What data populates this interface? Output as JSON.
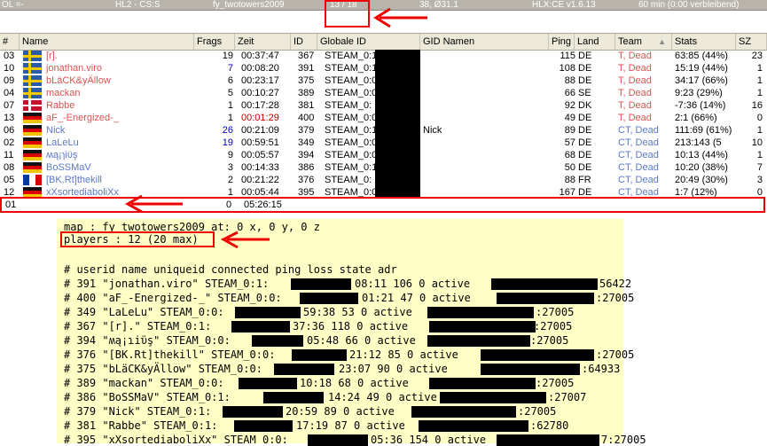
{
  "status_bar": {
    "left": "OL =-",
    "game": "HL2 - CS:S",
    "map": "fy_twotowers2009",
    "players": "13 / 18",
    "ping": "38, Ø31.1",
    "mod": "HLX:CE v1.6.13",
    "time": "60 min (0:00 verbleibend)"
  },
  "table": {
    "headers": [
      "#",
      "Name",
      "Frags",
      "Zeit",
      "ID",
      "Globale ID",
      "GID Namen",
      "Ping",
      "Land",
      "Team",
      "Stats",
      "SZ"
    ],
    "sort_indicator": "▲",
    "rows": [
      {
        "n": "03",
        "name": "[r].",
        "frags": "19",
        "time": "00:37:47",
        "id": "367",
        "gid": "STEAM_0:1",
        "gidname": "",
        "ping": "115",
        "land": "DE",
        "team": "T, Dead",
        "stats": "63:85 (44%)",
        "sz": "23",
        "flag": "se",
        "color": "#e05050",
        "fcolor": "#000",
        "tcolor": "#000"
      },
      {
        "n": "10",
        "name": "jonathan.viro",
        "frags": "7",
        "time": "00:08:20",
        "id": "391",
        "gid": "STEAM_0:1",
        "gidname": "",
        "ping": "108",
        "land": "DE",
        "team": "T, Dead",
        "stats": "15:19 (44%)",
        "sz": "1",
        "flag": "se",
        "color": "#e05050",
        "fcolor": "#0000c0",
        "tcolor": "#000"
      },
      {
        "n": "09",
        "name": "bLäCK&yÄllow",
        "frags": "6",
        "time": "00:23:17",
        "id": "375",
        "gid": "STEAM_0:0",
        "gidname": "",
        "ping": "88",
        "land": "DE",
        "team": "T, Dead",
        "stats": "34:17 (66%)",
        "sz": "1",
        "flag": "se",
        "color": "#e05050",
        "fcolor": "#000",
        "tcolor": "#000"
      },
      {
        "n": "04",
        "name": "mackan",
        "frags": "5",
        "time": "00:10:27",
        "id": "389",
        "gid": "STEAM_0:0",
        "gidname": "",
        "ping": "66",
        "land": "SE",
        "team": "T, Dead",
        "stats": "9:23 (29%)",
        "sz": "1",
        "flag": "se",
        "color": "#e05050",
        "fcolor": "#000",
        "tcolor": "#000"
      },
      {
        "n": "07",
        "name": "Rabbe",
        "frags": "1",
        "time": "00:17:28",
        "id": "381",
        "gid": "STEAM_0:",
        "gidname": "",
        "ping": "92",
        "land": "DK",
        "team": "T, Dead",
        "stats": "-7:36 (14%)",
        "sz": "16",
        "flag": "dk",
        "color": "#e05050",
        "fcolor": "#000",
        "tcolor": "#000"
      },
      {
        "n": "13",
        "name": "aF_-Energized-_",
        "frags": "1",
        "time": "00:01:29",
        "id": "400",
        "gid": "STEAM_0:0",
        "gidname": "",
        "ping": "49",
        "land": "DE",
        "team": "T, Dead",
        "stats": "2:1 (66%)",
        "sz": "0",
        "flag": "de",
        "color": "#e05050",
        "fcolor": "#000",
        "tcolor": "#c00000"
      },
      {
        "n": "06",
        "name": "Nick",
        "frags": "26",
        "time": "00:21:09",
        "id": "379",
        "gid": "STEAM_0:1",
        "gidname": "Nick",
        "ping": "89",
        "land": "DE",
        "team": "CT, Dead",
        "stats": "111:69 (61%)",
        "sz": "1",
        "flag": "de",
        "color": "#5a78c8",
        "fcolor": "#0000c0",
        "tcolor": "#000"
      },
      {
        "n": "02",
        "name": "LaLeLu",
        "frags": "19",
        "time": "00:59:51",
        "id": "349",
        "gid": "STEAM_0:0",
        "gidname": "",
        "ping": "57",
        "land": "DE",
        "team": "CT, Dead",
        "stats": "213:143 (5",
        "sz": "10",
        "flag": "de",
        "color": "#5a78c8",
        "fcolor": "#0000c0",
        "tcolor": "#000"
      },
      {
        "n": "11",
        "name": "ʍą¡ɿiϋş",
        "frags": "9",
        "time": "00:05:57",
        "id": "394",
        "gid": "STEAM_0:0",
        "gidname": "",
        "ping": "68",
        "land": "DE",
        "team": "CT, Dead",
        "stats": "10:13 (44%)",
        "sz": "1",
        "flag": "de",
        "color": "#5a78c8",
        "fcolor": "#000",
        "tcolor": "#000"
      },
      {
        "n": "08",
        "name": "BoSSMaV",
        "frags": "3",
        "time": "00:14:33",
        "id": "386",
        "gid": "STEAM_0:1",
        "gidname": "",
        "ping": "50",
        "land": "DE",
        "team": "CT, Dead",
        "stats": "10:20 (38%)",
        "sz": "7",
        "flag": "de",
        "color": "#5a78c8",
        "fcolor": "#000",
        "tcolor": "#000"
      },
      {
        "n": "05",
        "name": "[BK.Rt]thekill",
        "frags": "2",
        "time": "00:21:22",
        "id": "376",
        "gid": "STEAM_0:",
        "gidname": "",
        "ping": "88",
        "land": "FR",
        "team": "CT, Dead",
        "stats": "20:49 (30%)",
        "sz": "3",
        "flag": "fr",
        "color": "#5a78c8",
        "fcolor": "#000",
        "tcolor": "#000"
      },
      {
        "n": "12",
        "name": "xXsortediaboliXx",
        "frags": "1",
        "time": "00:05:44",
        "id": "395",
        "gid": "STEAM_0:0",
        "gidname": "",
        "ping": "167",
        "land": "DE",
        "team": "CT, Dead",
        "stats": "1:7 (12%)",
        "sz": "0",
        "flag": "de",
        "color": "#5a78c8",
        "fcolor": "#000",
        "tcolor": "#000"
      }
    ],
    "extra_row": {
      "n": "01",
      "frags": "0",
      "time": "05:26:15"
    }
  },
  "console": {
    "lines": [
      "map     : fy_twotowers2009 at: 0 x, 0 y, 0 z",
      "players : 12 (20 max)",
      "",
      "# userid name uniqueid connected ping loss state adr",
      "# 391 \"jonathan.viro\" STEAM_0:1:",
      "# 400 \"aF_-Energized-_\" STEAM_0:0:",
      "# 349 \"LaLeLu\" STEAM_0:0:",
      "# 367 \"[r].\" STEAM_0:1:",
      "# 394 \"ʍą¡ɿiϋş\" STEAM_0:0:",
      "# 376 \"[BK.Rt]thekill\" STEAM_0:0:",
      "# 375 \"bLäCK&yÄllow\" STEAM_0:0:",
      "# 389 \"mackan\" STEAM_0:0:",
      "# 386 \"BoSSMaV\" STEAM_0:1:",
      "# 379 \"Nick\" STEAM_0:1:",
      "# 381 \"Rabbe\" STEAM_0:1:",
      "# 395 \"xXsortediaboliXx\" STEAM 0:0:"
    ],
    "tails": [
      "",
      "",
      "",
      "",
      "08:11 106 0 active",
      "01:21 47 0 active",
      "59:38 53 0 active",
      "37:36 118 0 active",
      "05:48 66 0 active",
      "21:12 85 0 active",
      "23:07 90 0 active",
      "10:18 68 0 active",
      "14:24 49 0 active",
      "20:59 89 0 active",
      "17:19 87 0 active",
      "05:36 154 0 active"
    ],
    "ports": [
      "",
      "",
      "",
      "",
      "56422",
      ":27005",
      ":27005",
      ":27005",
      ":27005",
      ":27005",
      ":64933",
      ":27005",
      ":27007",
      ":27005",
      ":62780",
      "7:27005"
    ]
  }
}
